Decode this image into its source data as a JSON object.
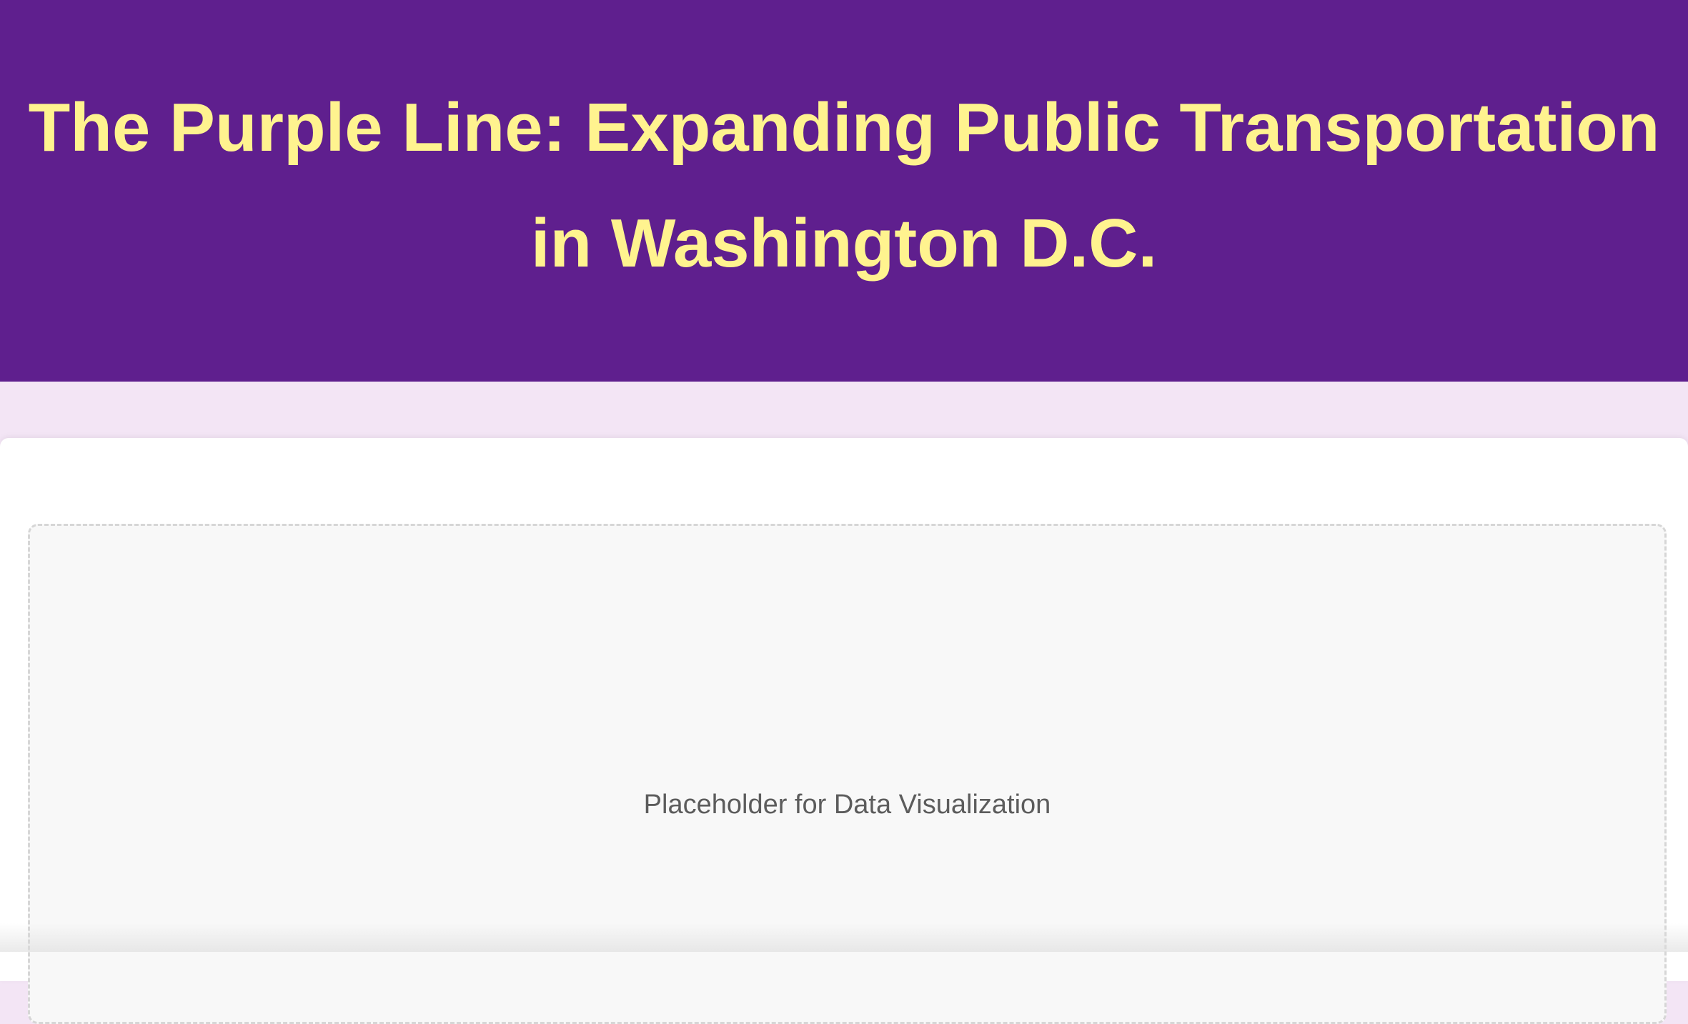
{
  "header": {
    "title": "The Purple Line: Expanding Public Transportation in Washington D.C.",
    "background_color": "#5f1f8e",
    "title_color": "#fff38f"
  },
  "main": {
    "visualization_placeholder": {
      "text": "Placeholder for Data Visualization"
    }
  },
  "colors": {
    "page_background": "#f3e5f5",
    "card_background": "#ffffff",
    "placeholder_background": "#f8f8f8",
    "placeholder_border": "#d6d6d6"
  }
}
